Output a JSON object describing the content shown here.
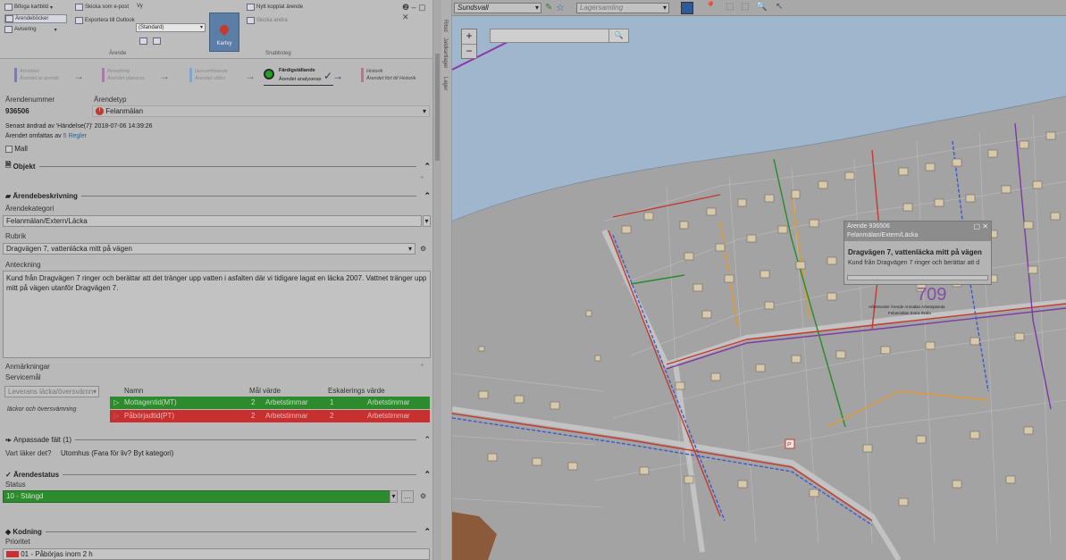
{
  "ribbon": {
    "btn_bifoga": "Bifoga kartbild",
    "btn_arendeboker": "Ärendeböcker",
    "btn_avisering": "Avisering",
    "btn_epost": "Skicka som e-post",
    "btn_outlook": "Exportera till Outlook",
    "vy_label": "Vy",
    "vy_value": "(Standard)",
    "btn_kartvy": "Kartvy",
    "btn_nytt": "Nytt kopplat ärende",
    "btn_skicka_andra": "Skicka andra",
    "group_arende": "Ärende",
    "group_snabbsteg": "Snabbsteg"
  },
  "window": {
    "controls": "❷ – ▢ ✕"
  },
  "workflow": {
    "steps": [
      {
        "title": "Anmälan",
        "sub": "Ärendet är anmält",
        "color": "#7d7da9"
      },
      {
        "title": "Beredning",
        "sub": "Ärendet planeras",
        "color": "#a97da9"
      },
      {
        "title": "Genomförande",
        "sub": "Ärendet utförs",
        "color": "#7da9c9"
      },
      {
        "title": "Färdigställande",
        "sub": "Ärendet analyseras",
        "color": "#1fa21f"
      },
      {
        "title": "Historik",
        "sub": "Ärendet fört till Historik",
        "color": "#a97d8d"
      }
    ]
  },
  "case": {
    "nummer_label": "Ärendenummer",
    "nummer_value": "936506",
    "typ_label": "Ärendetyp",
    "typ_value": "Felanmälan",
    "changed": "Senast ändrad av 'Händelse(7)' 2018-07-06 14:39:26",
    "omfattas_prefix": "Ärendet omfattas av",
    "omfattas_link": "5 Regler",
    "mall": "Mall"
  },
  "sections": {
    "objekt": "Objekt",
    "beskrivning": "Ärendebeskrivning",
    "anpassade": "Anpassade fält (1)",
    "status": "Ärendestatus",
    "kodning": "Kodning"
  },
  "beskrivning": {
    "kategori_label": "Ärendekategori",
    "kategori_value": "Felanmälan/Extern/Läcka",
    "rubrik_label": "Rubrik",
    "rubrik_value": "Dragvägen 7, vattenläcka mitt på vägen",
    "anteckning_label": "Anteckning",
    "anteckning_value": "Kund från Dragvägen 7 ringer och berättar att det tränger upp vatten i asfalten där vi tidigare lagat en läcka 2007. Vattnet tränger upp mitt på vägen utanför Dragvägen 7.",
    "anmarkningar_label": "Anmärkningar",
    "servicemal_label": "Servicemål",
    "servicemal_select": "Leverans läcka/översvämn",
    "servicemal_desc": "läckor och översvämning"
  },
  "service_table": {
    "headers": [
      "Namn",
      "Mål värde",
      "Eskalerings värde"
    ],
    "rows": [
      {
        "name": "Mottagentid(MT)",
        "mal": "2",
        "mal_unit": "Arbetstimmar",
        "esk": "1",
        "esk_unit": "Arbetstimmar"
      },
      {
        "name": "Påbörjadtid(PT)",
        "mal": "2",
        "mal_unit": "Arbetstimmar",
        "esk": "2",
        "esk_unit": "Arbetstimmar"
      }
    ]
  },
  "anpassade": {
    "label": "Vart läker det?",
    "value": "Utomhus (Fara för liv? Byt kategori)"
  },
  "status": {
    "label": "Status",
    "value": "10 - Stängd"
  },
  "kodning": {
    "prioritet_label": "Prioritet",
    "prioritet_value": "01 - Påbörjas inom 2 h"
  },
  "side_tabs": [
    "Ritsd",
    "Jaldkartlager",
    "Lager"
  ],
  "map": {
    "location_select": "Sundsvall",
    "layer_select": "Lagersamling",
    "zoom_in": "+",
    "zoom_out": "−",
    "search_placeholder": "",
    "popup": {
      "header1": "Ärende 936506",
      "header2": "Felanmälan/Extern/Läcka",
      "title": "Dragvägen 7, vattenläcka mitt på vägen",
      "body": "Kund från Dragvägen 7 ringer och berättar att d"
    },
    "marker_label": "P",
    "overlay_text_1": "Arbetsorder Ärende Anmälan Arbetsplanda",
    "overlay_text_2": "Felanmälan Extra Skala"
  },
  "colors": {
    "green": "#2d8a2d",
    "red": "#c83030",
    "water": "#9fb6cc"
  }
}
